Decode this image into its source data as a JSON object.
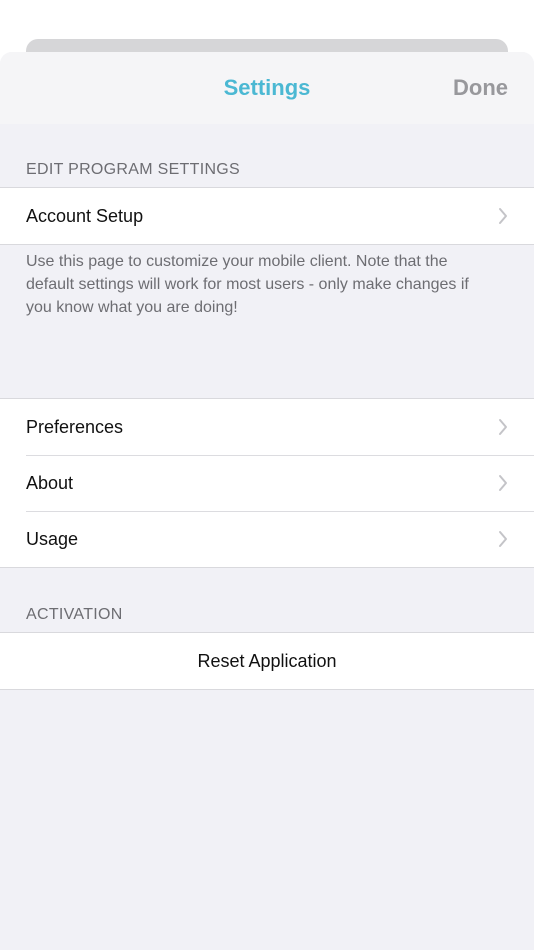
{
  "nav": {
    "title": "Settings",
    "done_label": "Done"
  },
  "sections": {
    "program": {
      "header": "EDIT PROGRAM SETTINGS",
      "account_setup_label": "Account Setup",
      "footer": "Use this page to customize your mobile client. Note that the default settings will work for most users - only make changes if you know what you are doing!"
    },
    "general": {
      "preferences_label": "Preferences",
      "about_label": "About",
      "usage_label": "Usage"
    },
    "activation": {
      "header": "ACTIVATION",
      "reset_label": "Reset Application"
    }
  },
  "icons": {
    "disclosure": "chevron-right-icon"
  },
  "colors": {
    "accent": "#4bb8d3",
    "done": "#98989c",
    "background": "#f1f1f6"
  }
}
